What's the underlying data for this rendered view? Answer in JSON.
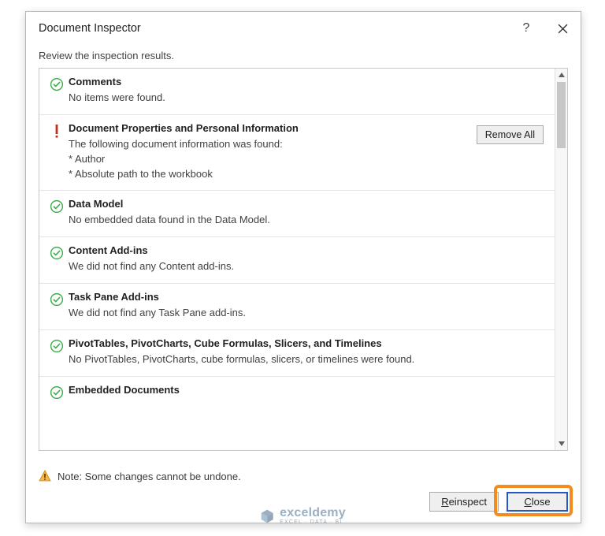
{
  "dialog": {
    "title": "Document Inspector",
    "help_tooltip": "Help",
    "close_tooltip": "Close"
  },
  "subheader": "Review the inspection results.",
  "items": [
    {
      "status": "ok",
      "title": "Comments",
      "desc": "No items were found."
    },
    {
      "status": "warn",
      "title": "Document Properties and Personal Information",
      "desc": "The following document information was found:\n* Author\n* Absolute path to the workbook",
      "action_label": "Remove All"
    },
    {
      "status": "ok",
      "title": "Data Model",
      "desc": "No embedded data found in the Data Model."
    },
    {
      "status": "ok",
      "title": "Content Add-ins",
      "desc": "We did not find any Content add-ins."
    },
    {
      "status": "ok",
      "title": "Task Pane Add-ins",
      "desc": "We did not find any Task Pane add-ins."
    },
    {
      "status": "ok",
      "title": "PivotTables, PivotCharts, Cube Formulas, Slicers, and Timelines",
      "desc": "No PivotTables, PivotCharts, cube formulas, slicers, or timelines were found."
    },
    {
      "status": "ok",
      "title": "Embedded Documents",
      "desc": ""
    }
  ],
  "footer": {
    "note": "Note: Some changes cannot be undone.",
    "reinspect": "Reinspect",
    "close": "Close"
  },
  "watermark": {
    "brand": "exceldemy",
    "tagline": "EXCEL · DATA · BI"
  }
}
